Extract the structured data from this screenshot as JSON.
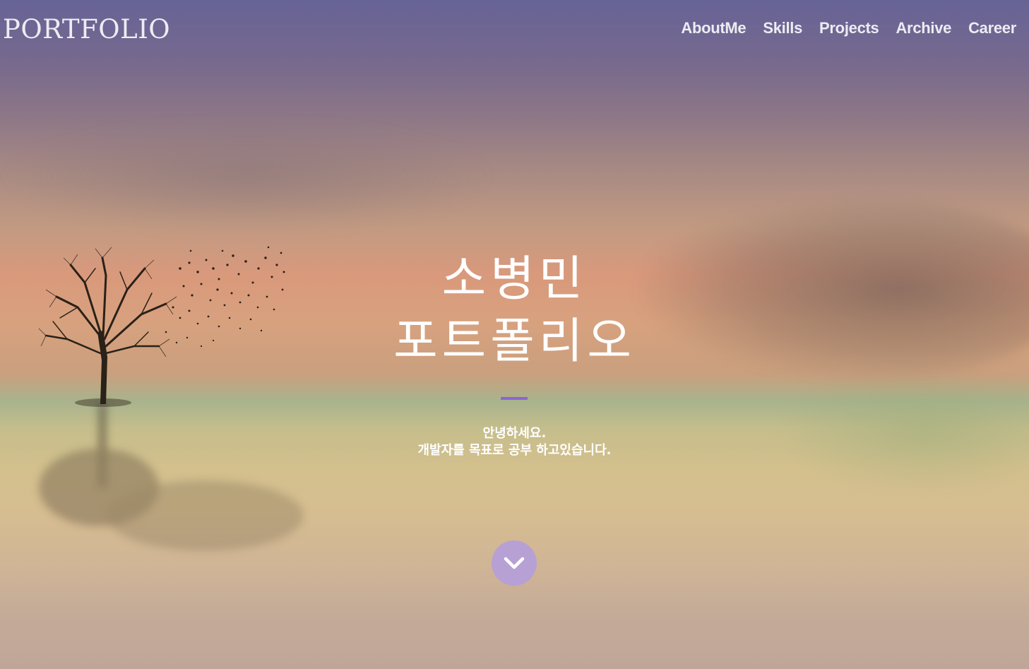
{
  "navbar": {
    "logo": "PORTFOLIO",
    "items": [
      {
        "label": "AboutMe"
      },
      {
        "label": "Skills"
      },
      {
        "label": "Projects"
      },
      {
        "label": "Archive"
      },
      {
        "label": "Career"
      }
    ]
  },
  "hero": {
    "title_line1": "소병민",
    "title_line2": "포트폴리오",
    "subtitle_line1": "안녕하세요.",
    "subtitle_line2": "개발자를 목표로 공부 하고있습니다.",
    "scroll_icon": "chevron-down-icon"
  },
  "colors": {
    "accent": "#8e63d6",
    "scroll_button": "#b7a0d4",
    "text": "#ffffff"
  }
}
